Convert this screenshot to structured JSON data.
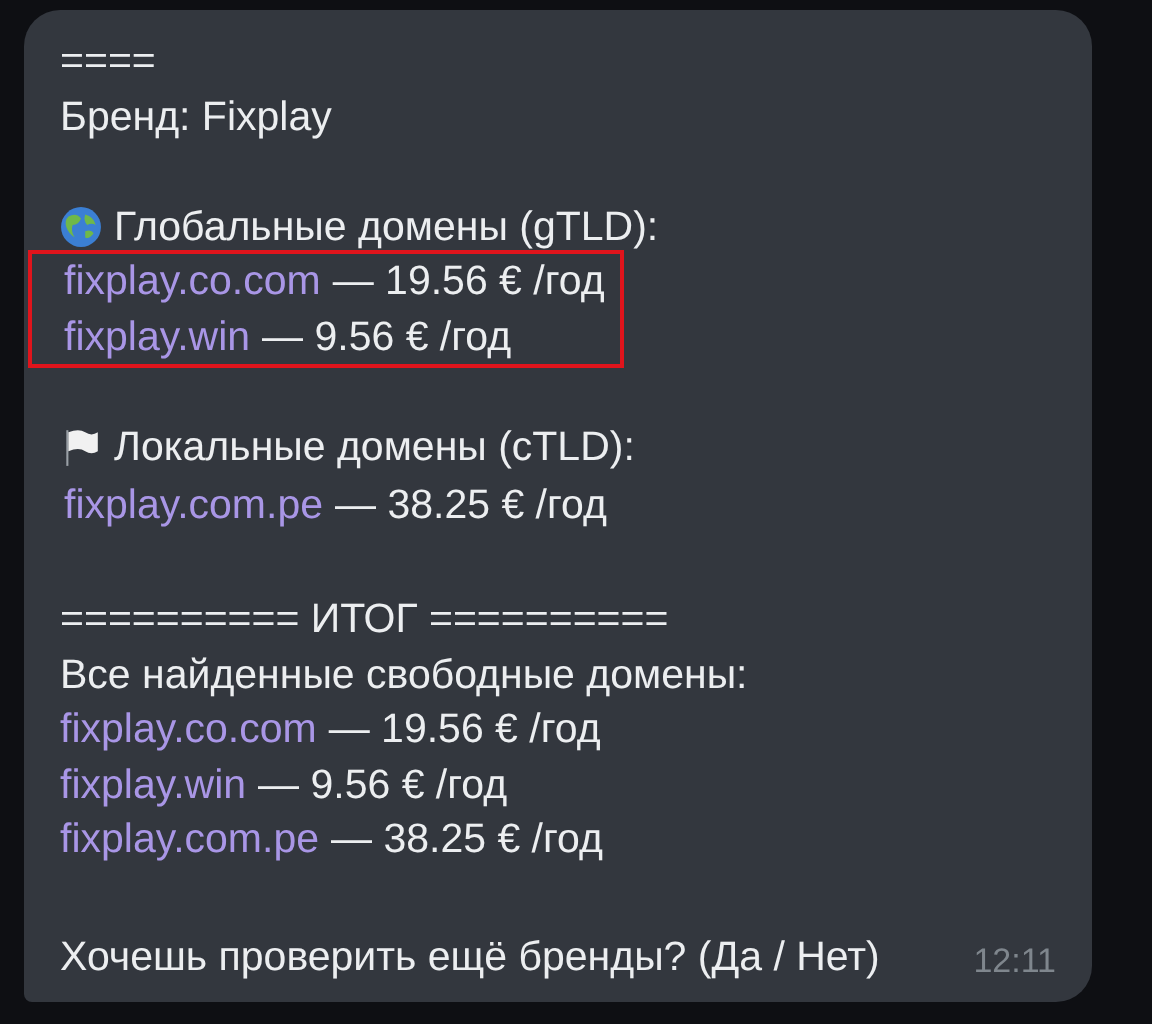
{
  "message": {
    "separator": "====",
    "brand": "Бренд: Fixplay",
    "sections": [
      {
        "kind": "global",
        "title": "Глобальные домены (gTLD):",
        "highlighted": true,
        "domains": [
          {
            "name": "fixplay.co.com",
            "price": "— 19.56 € /год"
          },
          {
            "name": "fixplay.win",
            "price": "— 9.56 € /год"
          }
        ]
      },
      {
        "kind": "local",
        "title": "Локальные домены (cTLD):",
        "highlighted": false,
        "domains": [
          {
            "name": "fixplay.com.pe",
            "price": "— 38.25 € /год"
          }
        ]
      }
    ],
    "summary": {
      "heading": "========== ИТОГ ==========",
      "subtitle": "Все найденные свободные домены:",
      "domains": [
        {
          "name": "fixplay.co.com",
          "price": "— 19.56 € /год"
        },
        {
          "name": "fixplay.win",
          "price": "— 9.56 € /год"
        },
        {
          "name": "fixplay.com.pe",
          "price": "— 38.25 € /год"
        }
      ]
    },
    "question": "Хочешь проверить ещё бренды? (Да / Нет)",
    "time": "12:11"
  }
}
